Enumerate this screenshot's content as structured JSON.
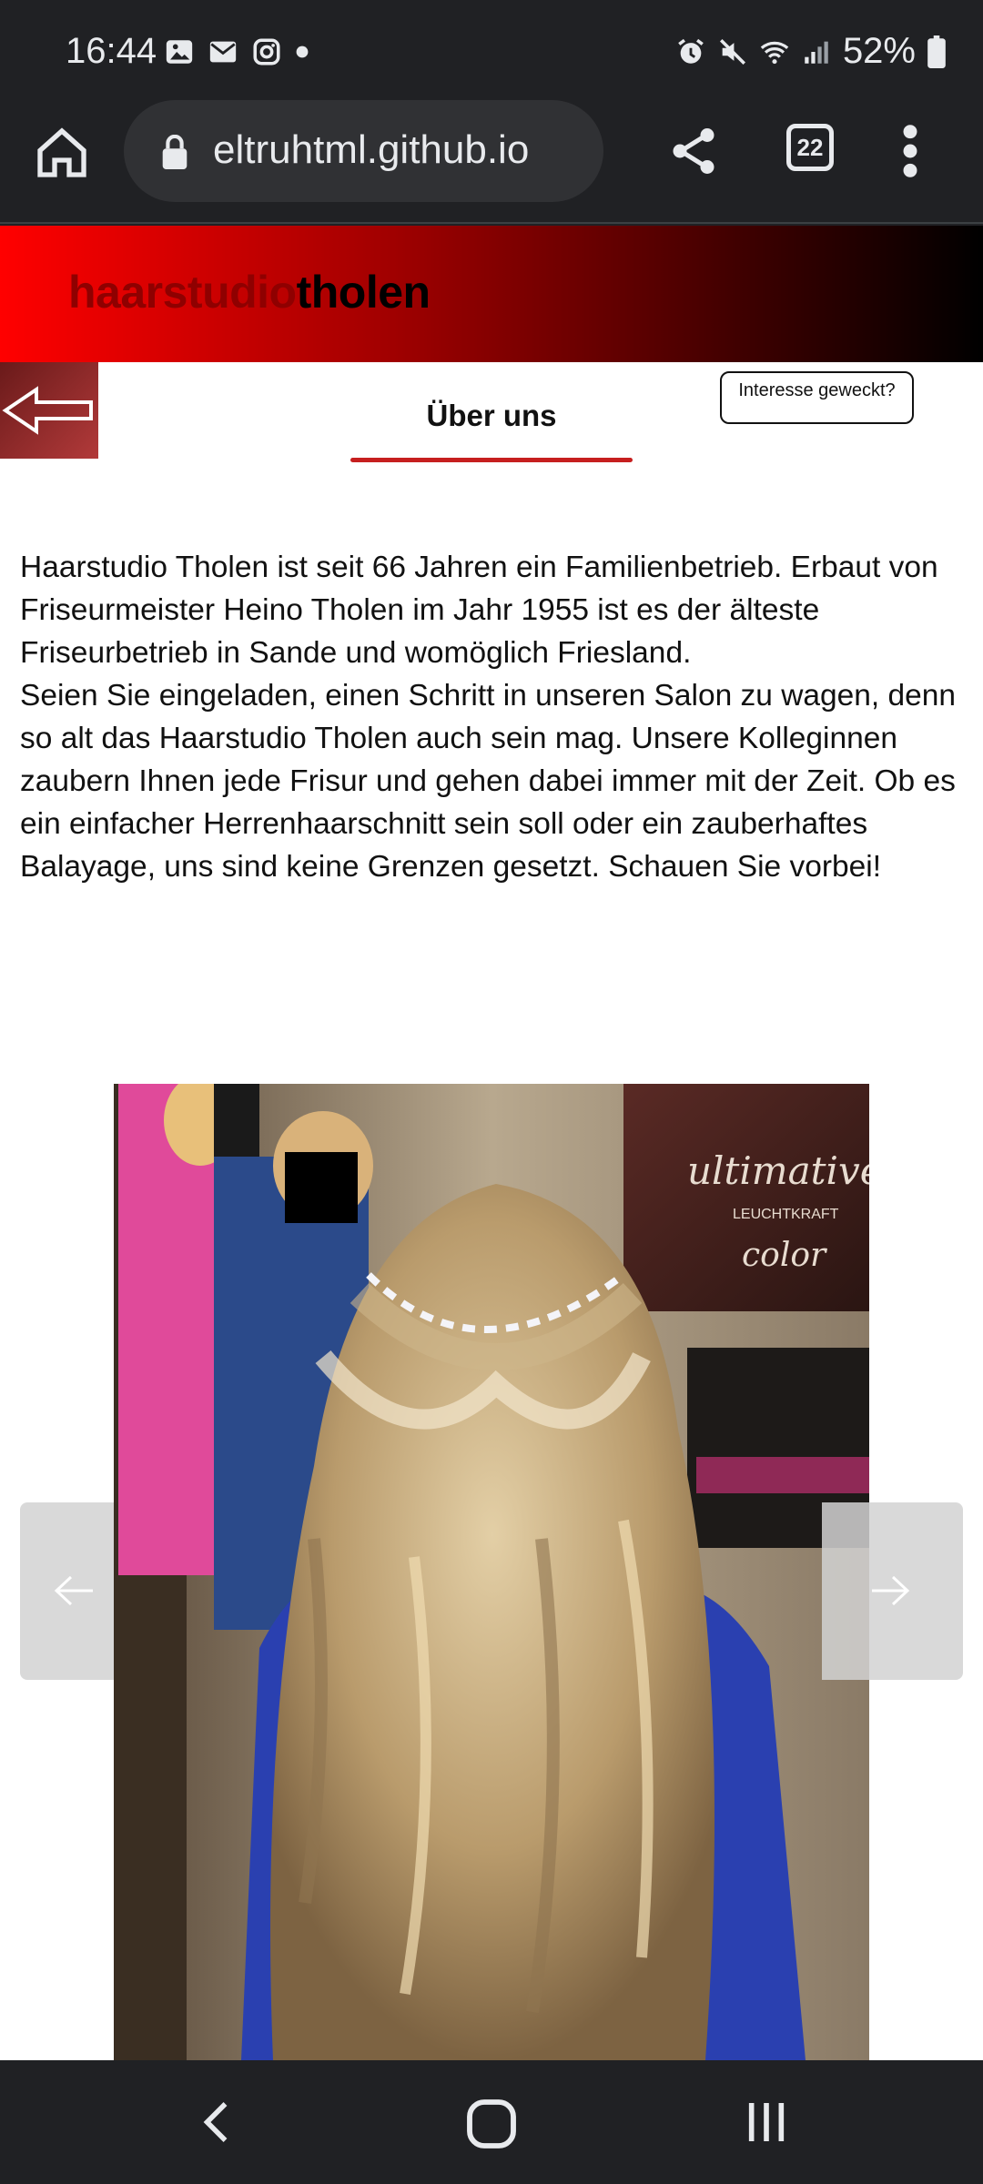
{
  "status_bar": {
    "time": "16:44",
    "battery": "52%",
    "icons": [
      "gallery-icon",
      "mail-icon",
      "instagram-icon",
      "dot-icon",
      "alarm-icon",
      "mute-icon",
      "wifi-icon",
      "signal-icon",
      "battery-icon"
    ]
  },
  "browser": {
    "url": "eltruhtml.github.io",
    "tab_count": "22"
  },
  "site": {
    "logo_part1": "haarstudio",
    "logo_part2": "tholen",
    "section_title": "Über uns",
    "interest_button": "Interesse geweckt?",
    "about_paragraph_1": "Haarstudio Tholen ist seit 66 Jahren ein Familienbetrieb. Erbaut von Friseurmeister Heino Tholen im Jahr 1955 ist es der älteste Friseurbetrieb in Sande und womöglich Friesland.",
    "about_paragraph_2": "Seien Sie eingeladen, einen Schritt in unseren Salon zu wagen, denn so alt das Haarstudio Tholen auch sein mag. Unsere Kolleginnen zaubern Ihnen jede Frisur und gehen dabei immer mit der Zeit. Ob es ein einfacher Herrenhaarschnitt sein soll oder ein zauberhaftes Balayage, uns sind keine Grenzen gesetzt. Schauen Sie vorbei!",
    "photo_sign_1": "ultimative",
    "photo_sign_2": "LEUCHTKRAFT",
    "photo_sign_3": "color"
  },
  "colors": {
    "header_red": "#ff0000",
    "accent_red": "#c61f1f",
    "pin_orange": "#ff3b00",
    "phone_red": "#e01010"
  }
}
